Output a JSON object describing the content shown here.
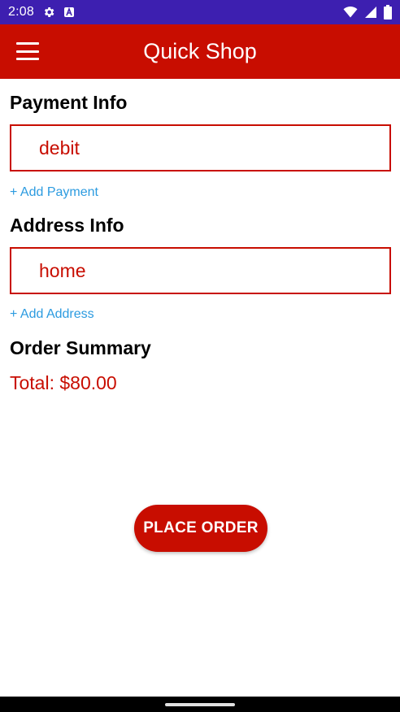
{
  "status_bar": {
    "time": "2:08",
    "icons": [
      "settings-gear-icon",
      "a-badge-icon",
      "wifi-icon",
      "signal-icon",
      "battery-icon"
    ],
    "color": "#3d1fb0"
  },
  "app_bar": {
    "title": "Quick Shop",
    "menu_icon": "hamburger-menu-icon",
    "color": "#c80d00"
  },
  "payment": {
    "heading": "Payment Info",
    "selected": "debit",
    "add_label": "+ Add Payment"
  },
  "address": {
    "heading": "Address Info",
    "selected": "home",
    "add_label": "+ Add Address"
  },
  "summary": {
    "heading": "Order Summary",
    "total": "Total: $80.00"
  },
  "actions": {
    "place_order_label": "PLACE ORDER"
  },
  "theme": {
    "accent": "#c80d00",
    "link": "#2c9be0"
  }
}
